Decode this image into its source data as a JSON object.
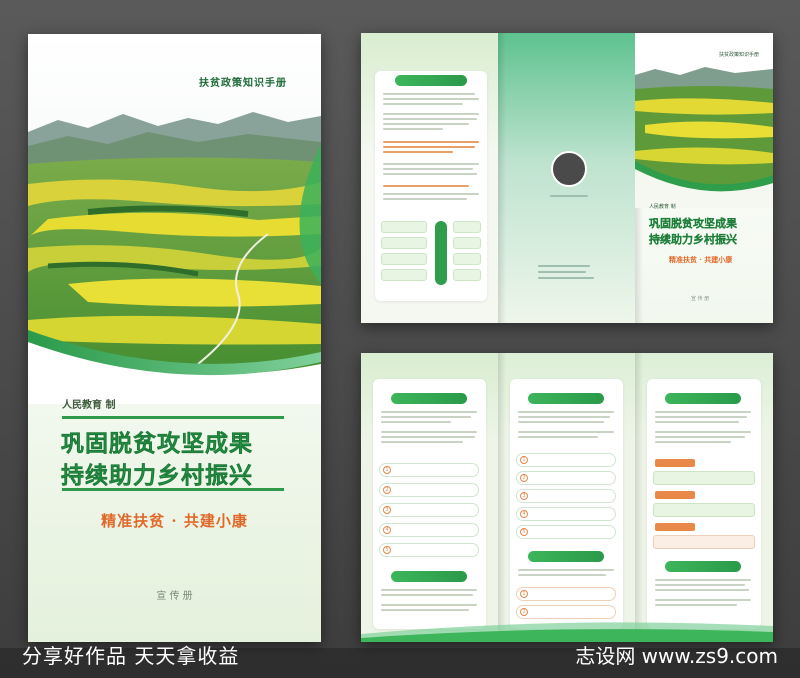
{
  "cover": {
    "handbook_title": "扶贫政策知识手册",
    "publisher": "人民教育   制",
    "title_line1": "巩固脱贫攻坚成果",
    "title_line2": "持续助力乡村振兴",
    "subtitle": "精准扶贫 · 共建小康",
    "bottom_label": "宣 传 册"
  },
  "outer_trifold": {
    "panel_right": {
      "handbook_title": "扶贫政策知识手册",
      "publisher": "人民教育   制",
      "title_line1": "巩固脱贫攻坚成果",
      "title_line2": "持续助力乡村振兴",
      "subtitle": "精准扶贫 · 共建小康",
      "bottom_label": "宣 传 册"
    }
  },
  "watermark": {
    "left_text": "分享好作品 天天拿收益",
    "right_text": "志设网 www.zs9.com"
  },
  "colors": {
    "brand_green": "#27a24a",
    "accent_orange": "#e0692a",
    "leaf_green": "#3db55a",
    "teal": "#4cbf8a"
  }
}
